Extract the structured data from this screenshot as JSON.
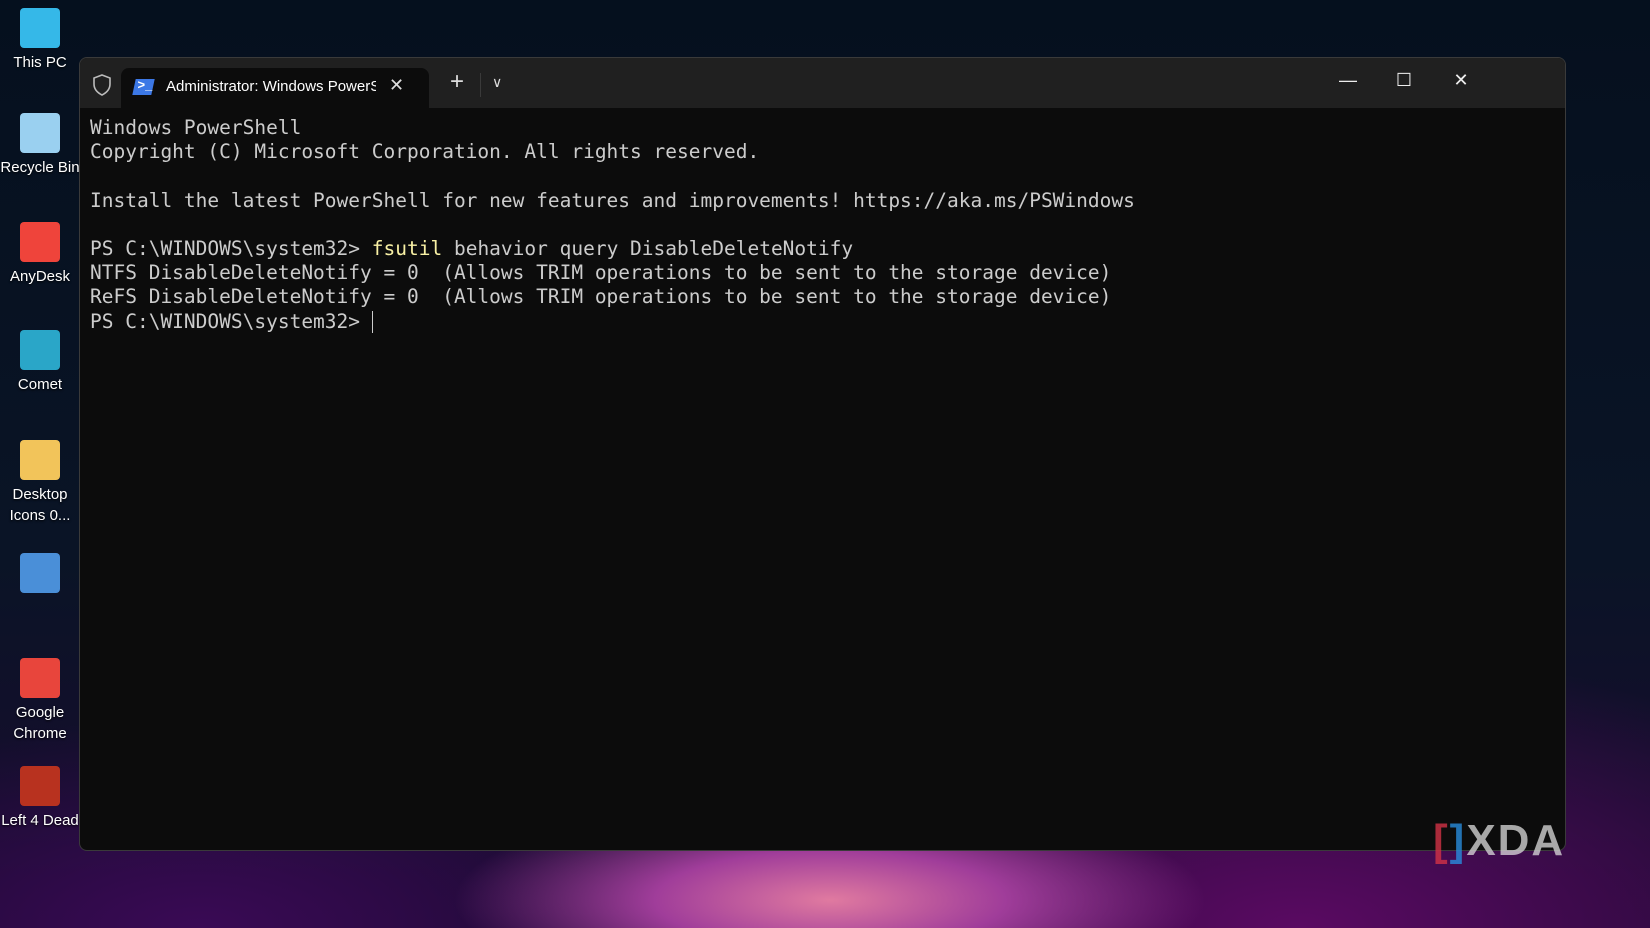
{
  "desktop": {
    "icons": [
      {
        "label": "This PC",
        "color": "#35b8e8"
      },
      {
        "label": "Recycle Bin",
        "color": "#9ad0f0"
      },
      {
        "label": "AnyDesk",
        "color": "#ef443b"
      },
      {
        "label": "Comet",
        "color": "#2aa6c8"
      },
      {
        "label": "Desktop Icons 0...",
        "color": "#f2c45a"
      },
      {
        "label": "",
        "color": "#4a8fd8"
      },
      {
        "label": "Google Chrome",
        "color": "#e8453c"
      },
      {
        "label": "Left 4 Dead",
        "color": "#b8321f"
      }
    ]
  },
  "window": {
    "tab_title": "Administrator: Windows PowerShell",
    "new_tab": "+",
    "dropdown": "⌄",
    "minimize": "—",
    "maximize": "☐",
    "close": "✕"
  },
  "terminal": {
    "lines": [
      "Windows PowerShell",
      "Copyright (C) Microsoft Corporation. All rights reserved.",
      "",
      "Install the latest PowerShell for new features and improvements! https://aka.ms/PSWindows",
      ""
    ],
    "prompt1": "PS C:\\WINDOWS\\system32> ",
    "cmd": "fsutil",
    "args": " behavior query DisableDeleteNotify",
    "out1": "NTFS DisableDeleteNotify = 0  (Allows TRIM operations to be sent to the storage device)",
    "out2": "ReFS DisableDeleteNotify = 0  (Allows TRIM operations to be sent to the storage device)",
    "prompt2": "PS C:\\WINDOWS\\system32> "
  },
  "watermark": {
    "text": "XDA"
  }
}
